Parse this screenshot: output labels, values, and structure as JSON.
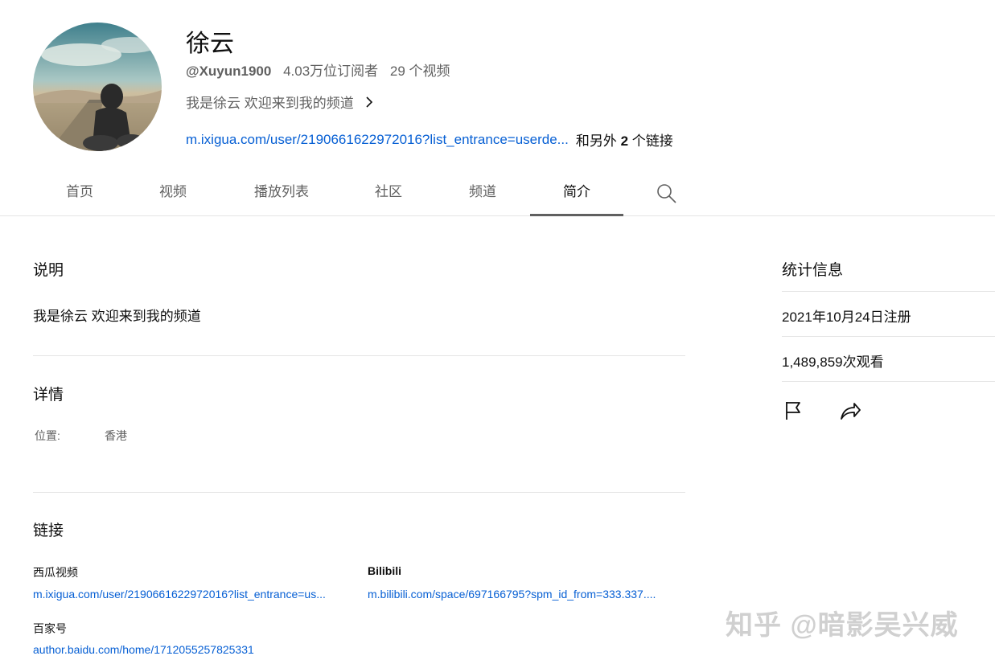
{
  "channel": {
    "name": "徐云",
    "handle": "@Xuyun1900",
    "subscribers": "4.03万位订阅者",
    "videos": "29 个视频",
    "tagline": "我是徐云 欢迎来到我的频道",
    "primary_link": "m.ixigua.com/user/2190661622972016?list_entrance=userde...",
    "more_links_prefix": "和另外",
    "more_links_count": "2",
    "more_links_suffix": "个链接"
  },
  "tabs": [
    {
      "label": "首页"
    },
    {
      "label": "视频"
    },
    {
      "label": "播放列表"
    },
    {
      "label": "社区"
    },
    {
      "label": "频道"
    },
    {
      "label": "简介",
      "active": true
    }
  ],
  "about": {
    "description_heading": "说明",
    "description_text": "我是徐云 欢迎来到我的频道",
    "details_heading": "详情",
    "location_label": "位置:",
    "location_value": "香港",
    "links_heading": "链接",
    "links": [
      {
        "name": "西瓜视频",
        "url": "m.ixigua.com/user/2190661622972016?list_entrance=us..."
      },
      {
        "name": "Bilibili",
        "url": "m.bilibili.com/space/697166795?spm_id_from=333.337...."
      },
      {
        "name": "百家号",
        "url": "author.baidu.com/home/1712055257825331"
      }
    ]
  },
  "stats": {
    "heading": "统计信息",
    "joined": "2021年10月24日注册",
    "views": "1,489,859次观看"
  },
  "watermark": "知乎 @暗影吴兴威",
  "colors": {
    "link": "#065fd4",
    "secondary_text": "#606060",
    "divider": "#e5e5e5",
    "active_tab_underline": "#606060"
  }
}
